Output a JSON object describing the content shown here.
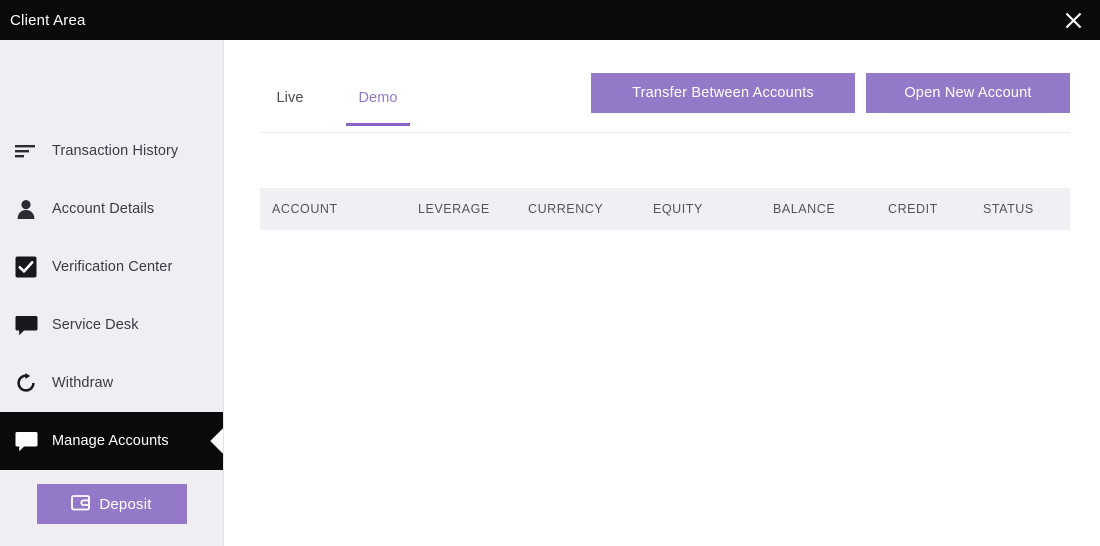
{
  "window": {
    "title": "Client Area",
    "close_icon": "close-icon"
  },
  "colors": {
    "accent_purple": "#9479c9",
    "tab_active": "#8a63c8",
    "sidebar_bg": "#eeeef3",
    "titlebar_bg": "#0a0a0a",
    "active_item_bg": "#0a0a0a",
    "table_header_bg": "#f0f0f4"
  },
  "sidebar": {
    "items": [
      {
        "label": "Transaction History",
        "icon": "sort-lines-icon",
        "active": false
      },
      {
        "label": "Account Details",
        "icon": "user-icon",
        "active": false
      },
      {
        "label": "Verification Center",
        "icon": "checkbox-checked-icon",
        "active": false
      },
      {
        "label": "Service Desk",
        "icon": "speech-bubble-icon",
        "active": false
      },
      {
        "label": "Withdraw",
        "icon": "refresh-rotate-icon",
        "active": false
      },
      {
        "label": "Manage Accounts",
        "icon": "speech-bubble-icon",
        "active": true
      }
    ],
    "deposit_button": {
      "label": "Deposit",
      "icon": "wallet-icon"
    }
  },
  "main": {
    "tabs": [
      {
        "label": "Live",
        "active": false
      },
      {
        "label": "Demo",
        "active": true
      }
    ],
    "actions": [
      {
        "label": "Transfer Between Accounts"
      },
      {
        "label": "Open New Account"
      }
    ],
    "table": {
      "columns": [
        "ACCOUNT",
        "LEVERAGE",
        "CURRENCY",
        "EQUITY",
        "BALANCE",
        "CREDIT",
        "STATUS"
      ],
      "rows": []
    }
  }
}
